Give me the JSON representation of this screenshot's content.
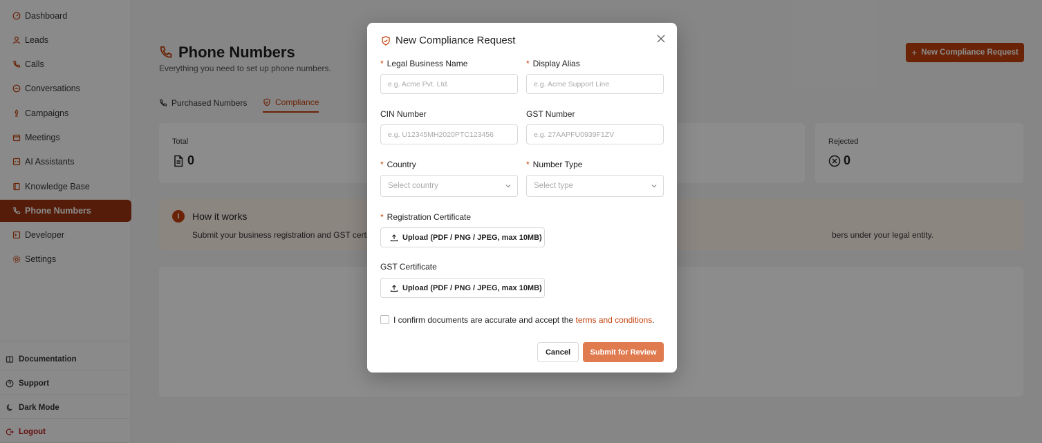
{
  "sidebar": {
    "items": [
      {
        "label": "Dashboard",
        "icon": "dashboard-icon"
      },
      {
        "label": "Leads",
        "icon": "user-icon"
      },
      {
        "label": "Calls",
        "icon": "phone-icon"
      },
      {
        "label": "Conversations",
        "icon": "chat-icon"
      },
      {
        "label": "Campaigns",
        "icon": "megaphone-icon"
      },
      {
        "label": "Meetings",
        "icon": "calendar-icon"
      },
      {
        "label": "AI Assistants",
        "icon": "bot-icon"
      },
      {
        "label": "Knowledge Base",
        "icon": "book-icon"
      },
      {
        "label": "Phone Numbers",
        "icon": "phone-icon",
        "active": true
      },
      {
        "label": "Developer",
        "icon": "terminal-icon"
      },
      {
        "label": "Settings",
        "icon": "gear-icon"
      }
    ],
    "footer": [
      {
        "label": "Documentation",
        "icon": "book-open-icon"
      },
      {
        "label": "Support",
        "icon": "help-circle-icon"
      },
      {
        "label": "Dark Mode",
        "icon": "moon-icon"
      },
      {
        "label": "Logout",
        "icon": "logout-icon"
      }
    ]
  },
  "header": {
    "title": "Phone Numbers",
    "subtitle": "Everything you need to set up phone numbers.",
    "primary_button": "New Compliance Request"
  },
  "tabs": [
    {
      "label": "Purchased Numbers"
    },
    {
      "label": "Compliance",
      "active": true
    }
  ],
  "stats": {
    "total": {
      "label": "Total",
      "value": "0"
    },
    "rejected": {
      "label": "Rejected",
      "value": "0"
    }
  },
  "info": {
    "title": "How it works",
    "text_start": "Submit your business registration and GST certi",
    "text_end": "bers under your legal entity."
  },
  "modal": {
    "title": "New Compliance Request",
    "legal_name": {
      "label": "Legal Business Name",
      "placeholder": "e.g. Acme Pvt. Ltd."
    },
    "display_alias": {
      "label": "Display Alias",
      "placeholder": "e.g. Acme Support Line"
    },
    "cin": {
      "label": "CIN Number",
      "placeholder": "e.g. U12345MH2020PTC123456"
    },
    "gst": {
      "label": "GST Number",
      "placeholder": "e.g. 27AAPFU0939F1ZV"
    },
    "country": {
      "label": "Country",
      "placeholder": "Select country"
    },
    "number_type": {
      "label": "Number Type",
      "placeholder": "Select type"
    },
    "reg_cert": {
      "label": "Registration Certificate",
      "button": "Upload (PDF / PNG / JPEG, max 10MB)"
    },
    "gst_cert": {
      "label": "GST Certificate",
      "button": "Upload (PDF / PNG / JPEG, max 10MB)"
    },
    "confirm_text": "I confirm documents are accurate and accept the ",
    "terms_link": "terms and conditions",
    "confirm_end": ".",
    "cancel": "Cancel",
    "submit": "Submit for Review"
  },
  "colors": {
    "accent": "#c2410c",
    "submit": "#e07a4f"
  }
}
